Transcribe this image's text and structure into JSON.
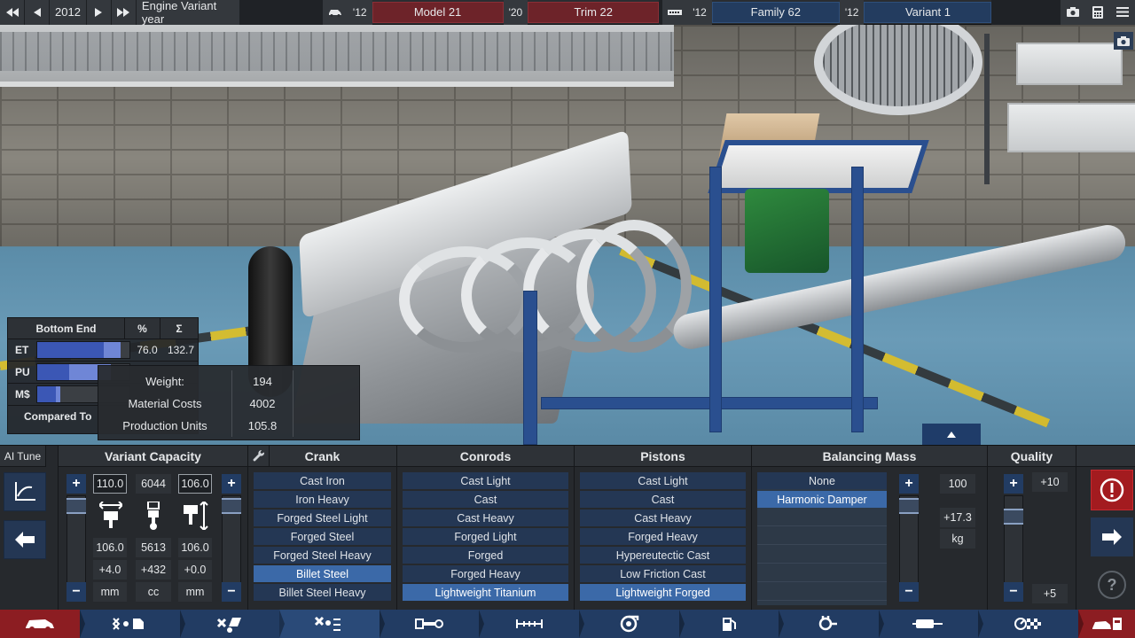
{
  "topbar": {
    "year": "2012",
    "title": "Engine Variant year",
    "model_year": "'12",
    "model_name": "Model 21",
    "trim_year": "'20",
    "trim_name": "Trim 22",
    "family_year": "'12",
    "family_name": "Family 62",
    "variant_year": "'12",
    "variant_name": "Variant 1"
  },
  "bottom_end": {
    "header": "Bottom End",
    "pct_header": "%",
    "sum_header": "Σ",
    "rows": [
      {
        "label": "ET",
        "pct": "76.0",
        "sum": "132.7",
        "fill": 0.72,
        "fill2_start": 0.72,
        "fill2": 0.18
      },
      {
        "label": "PU",
        "pct": "",
        "sum": "",
        "fill": 0.35,
        "fill2_start": 0.35,
        "fill2": 0.45
      },
      {
        "label": "M$",
        "pct": "",
        "sum": "",
        "fill": 0.2,
        "fill2_start": 0.2,
        "fill2": 0.05
      }
    ],
    "footer": "Compared To"
  },
  "weight_panel": {
    "rows": [
      {
        "label": "Weight:",
        "value": "194"
      },
      {
        "label": "Material Costs",
        "value": "4002"
      },
      {
        "label": "Production Units",
        "value": "105.8"
      }
    ]
  },
  "panel": {
    "ai_tune": "AI Tune",
    "variant_capacity": {
      "title": "Variant Capacity",
      "bore": "110.0",
      "cc": "6044",
      "stroke": "106.0",
      "bore2": "106.0",
      "cc2": "5613",
      "stroke2": "106.0",
      "bore_diff": "+4.0",
      "cc_diff": "+432",
      "stroke_diff": "+0.0",
      "unit_bore": "mm",
      "unit_cc": "cc",
      "unit_stroke": "mm"
    },
    "crank": {
      "title": "Crank",
      "options": [
        "Cast Iron",
        "Iron Heavy",
        "Forged Steel Light",
        "Forged Steel",
        "Forged Steel Heavy",
        "Billet Steel",
        "Billet Steel Heavy"
      ],
      "selected": "Billet Steel"
    },
    "conrods": {
      "title": "Conrods",
      "options": [
        "Cast Light",
        "Cast",
        "Cast Heavy",
        "Forged Light",
        "Forged",
        "Forged Heavy",
        "Lightweight Titanium"
      ],
      "selected": "Lightweight Titanium"
    },
    "pistons": {
      "title": "Pistons",
      "options": [
        "Cast Light",
        "Cast",
        "Cast Heavy",
        "Forged Heavy",
        "Hypereutectic Cast",
        "Low Friction Cast",
        "Lightweight Forged"
      ],
      "selected": "Lightweight Forged"
    },
    "balancing_mass": {
      "title": "Balancing Mass",
      "options": [
        "None",
        "Harmonic Damper"
      ],
      "selected": "Harmonic Damper",
      "value": "100",
      "diff": "+17.3",
      "unit": "kg"
    },
    "quality": {
      "title": "Quality",
      "top": "+10",
      "bottom": "+5"
    }
  },
  "colors": {
    "accent_blue": "#223c63",
    "selected_blue": "#3b69a8",
    "alert_red": "#a31b1f",
    "tab_red": "#8c1d22"
  }
}
